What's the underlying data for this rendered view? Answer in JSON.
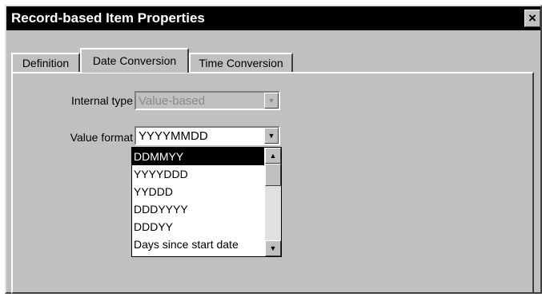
{
  "window": {
    "title": "Record-based Item Properties",
    "close_label": "×"
  },
  "tabs": [
    {
      "label": "Definition"
    },
    {
      "label": "Date Conversion"
    },
    {
      "label": "Time Conversion"
    }
  ],
  "form": {
    "internal_type_label": "Internal type",
    "internal_type_value": "Value-based",
    "value_format_label": "Value format",
    "value_format_value": "YYYYMMDD"
  },
  "dropdown": {
    "options": [
      "DDMMYY",
      "YYYYDDD",
      "YYDDD",
      "DDDYYYY",
      "DDDYY",
      "Days since start date"
    ],
    "selected": "DDMMYY"
  },
  "icons": {
    "combo_arrow": "▼",
    "scroll_up": "▲",
    "scroll_down": "▼"
  },
  "colors": {
    "titlebar": "#000000",
    "dialog_face": "#c0c0c0",
    "selected_item": "#000000"
  }
}
